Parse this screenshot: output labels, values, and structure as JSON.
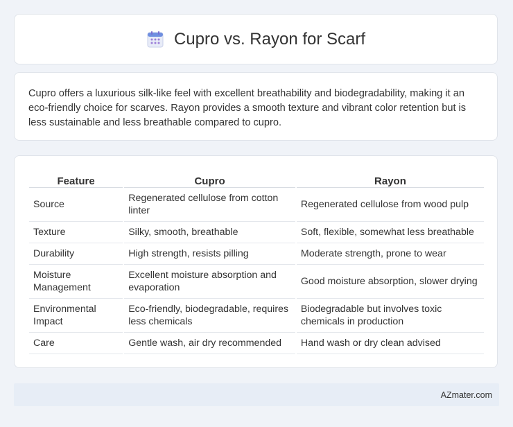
{
  "header": {
    "title": "Cupro vs. Rayon for Scarf",
    "icon": "calendar-icon"
  },
  "intro": {
    "text": "Cupro offers a luxurious silk-like feel with excellent breathability and biodegradability, making it an eco-friendly choice for scarves. Rayon provides a smooth texture and vibrant color retention but is less sustainable and less breathable compared to cupro."
  },
  "table": {
    "headers": [
      "Feature",
      "Cupro",
      "Rayon"
    ],
    "rows": [
      [
        "Source",
        "Regenerated cellulose from cotton linter",
        "Regenerated cellulose from wood pulp"
      ],
      [
        "Texture",
        "Silky, smooth, breathable",
        "Soft, flexible, somewhat less breathable"
      ],
      [
        "Durability",
        "High strength, resists pilling",
        "Moderate strength, prone to wear"
      ],
      [
        "Moisture Management",
        "Excellent moisture absorption and evaporation",
        "Good moisture absorption, slower drying"
      ],
      [
        "Environmental Impact",
        "Eco-friendly, biodegradable, requires less chemicals",
        "Biodegradable but involves toxic chemicals in production"
      ],
      [
        "Care",
        "Gentle wash, air dry recommended",
        "Hand wash or dry clean advised"
      ]
    ]
  },
  "footer": {
    "text": "AZmater.com"
  },
  "colors": {
    "background": "#f0f3f8",
    "card": "#ffffff",
    "footer_bg": "#e7edf6"
  }
}
